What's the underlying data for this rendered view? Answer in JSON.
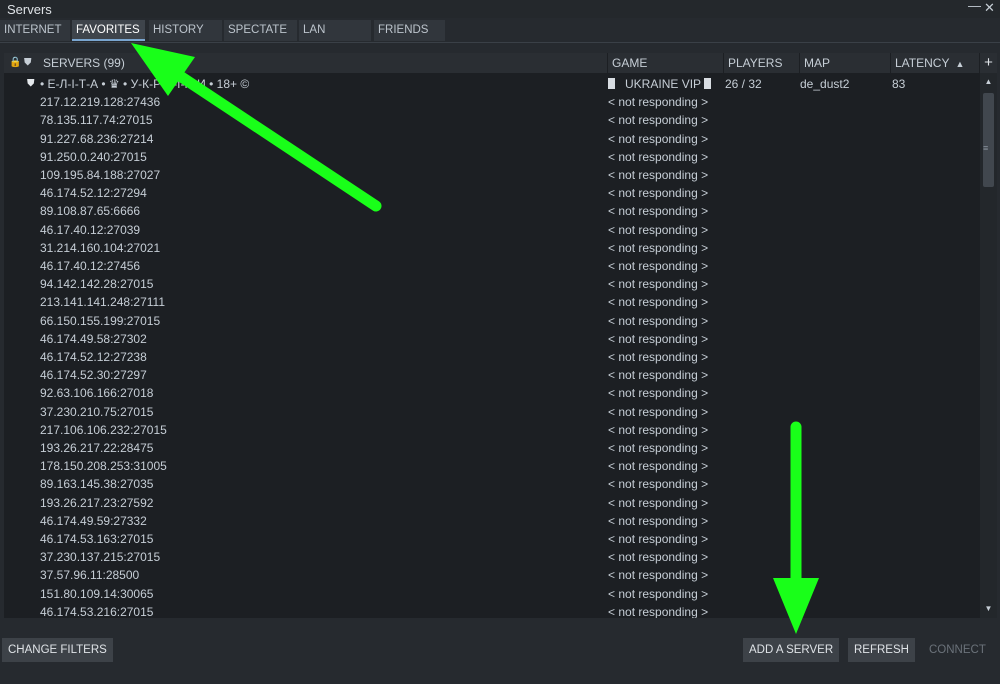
{
  "window": {
    "title": "Servers",
    "minimize_glyph": "—",
    "close_glyph": "✕"
  },
  "tabs": [
    {
      "label": "INTERNET",
      "active": false
    },
    {
      "label": "FAVORITES",
      "active": true
    },
    {
      "label": "HISTORY",
      "active": false
    },
    {
      "label": "SPECTATE",
      "active": false
    },
    {
      "label": "LAN",
      "active": false
    },
    {
      "label": "FRIENDS",
      "active": false
    }
  ],
  "columns": {
    "servers": "SERVERS (99)",
    "game": "GAME",
    "players": "PLAYERS",
    "map": "MAP",
    "latency": "LATENCY",
    "latency_sort_glyph": "▲",
    "add_glyph": "+",
    "lock_glyph": "🔒",
    "shield_glyph": "⛊"
  },
  "servers": [
    {
      "name": "• Е-Л-І-Т-А • ♛ • У-К-Р-А-Ї-Н-И • 18+ ©",
      "game": "UKRAINE VIP",
      "players": "26 / 32",
      "map": "de_dust2",
      "latency": "83",
      "favorite_icon": "⛊"
    },
    {
      "name": "217.12.219.128:27436",
      "game": "< not responding >"
    },
    {
      "name": "78.135.117.74:27015",
      "game": "< not responding >"
    },
    {
      "name": "91.227.68.236:27214",
      "game": "< not responding >"
    },
    {
      "name": "91.250.0.240:27015",
      "game": "< not responding >"
    },
    {
      "name": "109.195.84.188:27027",
      "game": "< not responding >"
    },
    {
      "name": "46.174.52.12:27294",
      "game": "< not responding >"
    },
    {
      "name": "89.108.87.65:6666",
      "game": "< not responding >"
    },
    {
      "name": "46.17.40.12:27039",
      "game": "< not responding >"
    },
    {
      "name": "31.214.160.104:27021",
      "game": "< not responding >"
    },
    {
      "name": "46.17.40.12:27456",
      "game": "< not responding >"
    },
    {
      "name": "94.142.142.28:27015",
      "game": "< not responding >"
    },
    {
      "name": "213.141.141.248:27111",
      "game": "< not responding >"
    },
    {
      "name": "66.150.155.199:27015",
      "game": "< not responding >"
    },
    {
      "name": "46.174.49.58:27302",
      "game": "< not responding >"
    },
    {
      "name": "46.174.52.12:27238",
      "game": "< not responding >"
    },
    {
      "name": "46.174.52.30:27297",
      "game": "< not responding >"
    },
    {
      "name": "92.63.106.166:27018",
      "game": "< not responding >"
    },
    {
      "name": "37.230.210.75:27015",
      "game": "< not responding >"
    },
    {
      "name": "217.106.106.232:27015",
      "game": "< not responding >"
    },
    {
      "name": "193.26.217.22:28475",
      "game": "< not responding >"
    },
    {
      "name": "178.150.208.253:31005",
      "game": "< not responding >"
    },
    {
      "name": "89.163.145.38:27035",
      "game": "< not responding >"
    },
    {
      "name": "193.26.217.23:27592",
      "game": "< not responding >"
    },
    {
      "name": "46.174.49.59:27332",
      "game": "< not responding >"
    },
    {
      "name": "46.174.53.163:27015",
      "game": "< not responding >"
    },
    {
      "name": "37.230.137.215:27015",
      "game": "< not responding >"
    },
    {
      "name": "37.57.96.11:28500",
      "game": "< not responding >"
    },
    {
      "name": "151.80.109.14:30065",
      "game": "< not responding >"
    },
    {
      "name": "46.174.53.216:27015",
      "game": "< not responding >"
    }
  ],
  "scrollbar": {
    "up_glyph": "▲",
    "down_glyph": "▼",
    "grip_glyph": "≡"
  },
  "buttons": {
    "change_filters": "CHANGE FILTERS",
    "add_server": "ADD A SERVER",
    "refresh": "REFRESH",
    "connect": "CONNECT"
  },
  "colors": {
    "window_bg": "#262a2f",
    "list_bg": "#1c1f23",
    "annotation_arrow": "#19ff19",
    "tab_active_underline": "#7aa6d0"
  }
}
